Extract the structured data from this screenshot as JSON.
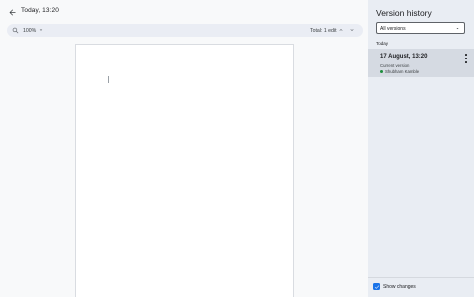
{
  "header": {
    "title": "Today, 13:20",
    "back_icon": "arrow-back-icon"
  },
  "toolbar": {
    "zoom": "100%",
    "edits": "Total: 1 edit",
    "zoom_icon": "zoom-icon"
  },
  "panel": {
    "title": "Version history",
    "filter": "All versions",
    "group_label": "Today",
    "versions": [
      {
        "title": "17 August, 13:20",
        "subtitle": "Current version",
        "author": "Shubham Kamble",
        "author_color": "#1e8e3e"
      }
    ]
  },
  "footer": {
    "show_changes_label": "Show changes",
    "show_changes_checked": true
  },
  "colors": {
    "accent": "#1a73e8",
    "panel_bg": "#e9edf3",
    "selected_bg": "#d5dae2"
  }
}
